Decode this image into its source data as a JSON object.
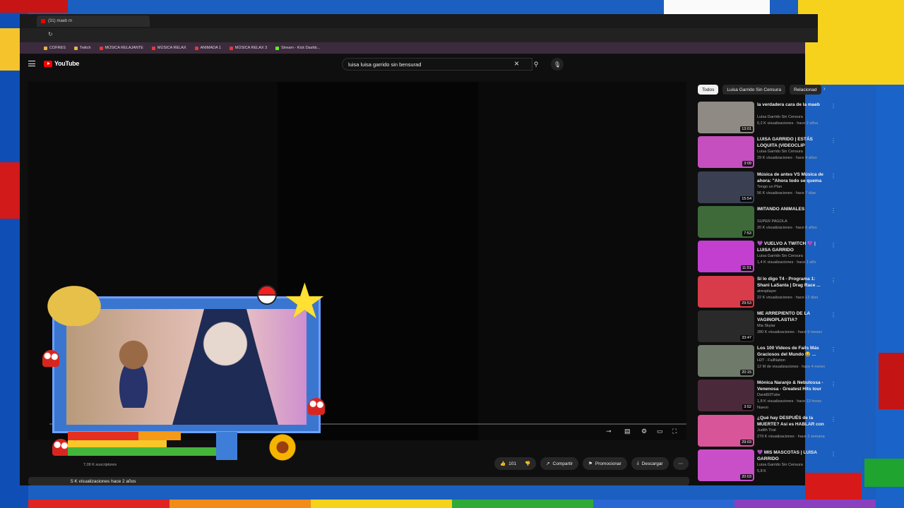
{
  "browser": {
    "tab_title": "(31) maeb m",
    "bookmarks": [
      {
        "label": "COFRES",
        "color": "#e2b93b"
      },
      {
        "label": "Twitch",
        "color": "#e2b93b"
      },
      {
        "label": "MÚSICA RELAJANTE",
        "color": "#e53935"
      },
      {
        "label": "MÚSICA RELAX",
        "color": "#e53935"
      },
      {
        "label": "ANIMADA 1",
        "color": "#e53935"
      },
      {
        "label": "MÚSICA RELAX 3",
        "color": "#e53935"
      },
      {
        "label": "Stream - Kick Dashb...",
        "color": "#53fc18"
      }
    ]
  },
  "youtube": {
    "logo_text": "YouTube",
    "search_value": "luisa luisa garrido sin bensurad",
    "subscribers": "7,09 K suscriptores",
    "actions": {
      "likes": "101",
      "share": "Compartir",
      "promote": "Promocionar",
      "download": "Descargar"
    },
    "description_meta": "5 K visualizaciones  hace 2 años"
  },
  "sidebar": {
    "chips": [
      "Todos",
      "Luisa Garrido Sin Censura",
      "Relacionad"
    ],
    "videos": [
      {
        "title": "la verdadera cara de la maeb",
        "channel": "Luisa Garrido Sin Censura",
        "meta": "6,2 K visualizaciones · hace 2 años",
        "duration": "13:01",
        "thumb": "#8f8a84"
      },
      {
        "title": "LUISA GARRIDO | ESTÁS LOQUITA (VIDEOCLIP OFICIAL...",
        "channel": "Luisa Garrido Sin Censura",
        "meta": "29 K visualizaciones · hace 4 años",
        "duration": "3:09",
        "thumb": "#c64fc0"
      },
      {
        "title": "Música de antes VS Música de ahora: \"Ahora todo se quema ...",
        "channel": "Tengo un Plan",
        "meta": "56 K visualizaciones · hace 7 días",
        "duration": "15:54",
        "thumb": "#3b3f52"
      },
      {
        "title": "IMITANDO ANIMALES",
        "channel": "SUPER PAGOLA",
        "meta": "20 K visualizaciones · hace 6 años",
        "duration": "7:53",
        "thumb": "#3e6a3a"
      },
      {
        "title": "💜 VUELVO A TWITCH 💜 | LUISA GARRIDO",
        "channel": "Luisa Garrido Sin Censura",
        "meta": "1,4 K visualizaciones · hace 1 año",
        "duration": "11:51",
        "thumb": "#c23fd0"
      },
      {
        "title": "Sí lo digo T4 - Programa 1: Shani LaSanta | Drag Race ...",
        "channel": "atresplayer",
        "meta": "22 K visualizaciones · hace 12 días",
        "duration": "29:53",
        "thumb": "#d83b4a"
      },
      {
        "title": "ME ARREPIENTO DE LA VAGINOPLASTIA?",
        "channel": "Mia Skylar",
        "meta": "280 K visualizaciones · hace 9 meses",
        "duration": "33:47",
        "thumb": "#2a2a2a"
      },
      {
        "title": "Los 100 Videos de Fails Más Graciosos del Mundo 😂 ...",
        "channel": "H2T - FailNation",
        "meta": "12 M de visualizaciones · hace 4 meses",
        "duration": "20:15",
        "thumb": "#6f7a6a"
      },
      {
        "title": "Mónica Naranjo & Nebulossa - Venenosa - Greatest Hits tour ...",
        "channel": "David93Tube",
        "meta": "1,8 K visualizaciones · hace 13 horas",
        "duration": "3:52",
        "thumb": "#4a2a3a",
        "badge": "Nuevo"
      },
      {
        "title": "¿Qué hay DESPUÉS de la MUERTE? Así es HABLAR con ...",
        "channel": "Judith Tiral",
        "meta": "279 K visualizaciones · hace 2 semanas",
        "duration": "29:03",
        "thumb": "#d9559a"
      },
      {
        "title": "💜 MIS MASCOTAS | LUISA GARRIDO",
        "channel": "Luisa Garrido Sin Censura",
        "meta": "5,8 K",
        "duration": "20:03",
        "thumb": "#c94fc8"
      }
    ]
  }
}
